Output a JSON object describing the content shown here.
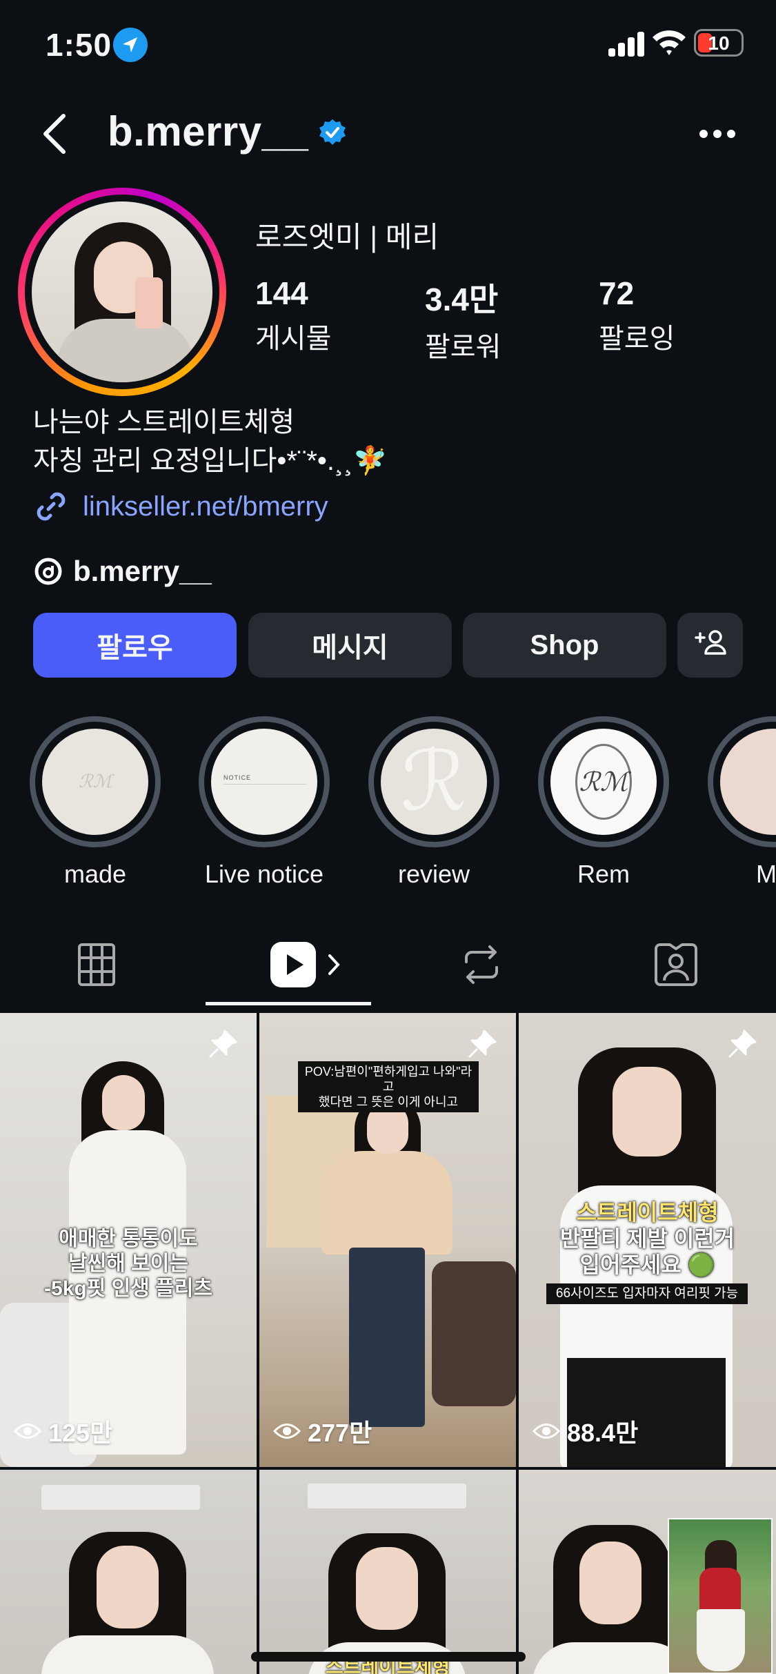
{
  "status_bar": {
    "time": "1:50",
    "battery": "10"
  },
  "header": {
    "username": "b.merry__"
  },
  "profile": {
    "display_name": "로즈엣미 | 메리",
    "stats": [
      {
        "value": "144",
        "label": "게시물"
      },
      {
        "value": "3.4만",
        "label": "팔로워"
      },
      {
        "value": "72",
        "label": "팔로잉"
      }
    ],
    "bio": [
      "나는야 스트레이트체형",
      "자칭 관리 요정입니다•*¨*•.¸¸🧚"
    ],
    "link": "linkseller.net/bmerry",
    "threads": "b.merry__"
  },
  "actions": {
    "follow": "팔로우",
    "message": "메시지",
    "shop": "Shop"
  },
  "highlights": [
    {
      "label": "made"
    },
    {
      "label": "Live notice",
      "cover_text": "NOTICE"
    },
    {
      "label": "review"
    },
    {
      "label": "Rem"
    },
    {
      "label": "Mo"
    }
  ],
  "tabs": [
    "grid-icon",
    "reels-icon",
    "reposts-icon",
    "tagged-icon"
  ],
  "reels": [
    {
      "views": "125만",
      "pinned": true,
      "overlay": [
        "애매한 통통이도",
        "날씬해 보이는",
        "-5kg핏 인생 플리츠"
      ]
    },
    {
      "views": "277만",
      "pinned": true,
      "caption": [
        "POV:남편이\"편하게입고 나와\"라고",
        "했다면 그 뜻은 이게 아니고"
      ]
    },
    {
      "views": "88.4만",
      "pinned": true,
      "overlay": [
        "스트레이트체형",
        "반팔티 제발 이런거",
        "입어주세요 🟢"
      ],
      "caption": [
        "66사이즈도 입자마자 여리핏 가능"
      ]
    },
    {
      "overlay": [
        "스트레이트체형"
      ]
    },
    {},
    {}
  ],
  "colors": {
    "follow_button": "#4a5df9",
    "link": "#8aa4ff",
    "verified": "#1d9bf0",
    "background": "#0c1014"
  }
}
